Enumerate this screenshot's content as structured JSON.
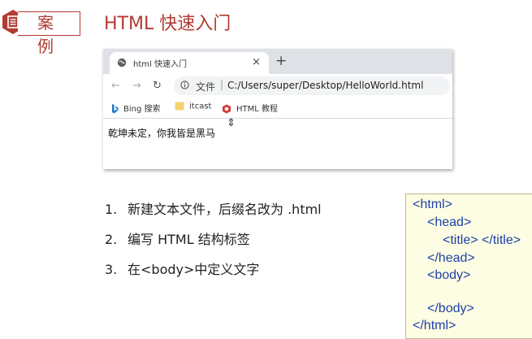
{
  "header": {
    "badge_label": "案例",
    "title": "HTML 快速入门"
  },
  "browser": {
    "tab_title": "html 快速入门",
    "tab_close": "×",
    "new_tab": "+",
    "nav_back": "←",
    "nav_forward": "→",
    "nav_reload": "↻",
    "omnibox_prefix": "文件",
    "omnibox_separator": "|",
    "url": "C:/Users/super/Desktop/HelloWorld.html",
    "bookmarks": [
      {
        "label": "Bing 搜索",
        "icon": "bing-icon",
        "color": "#1e73c7"
      },
      {
        "label": "itcast",
        "icon": "folder-icon",
        "color": "#f5d170"
      },
      {
        "label": "HTML 教程",
        "icon": "shield-logo-icon",
        "color": "#d33a3a"
      }
    ],
    "page_text": "乾坤未定，你我皆是黑马",
    "cursor": "⇕"
  },
  "steps": [
    {
      "num": "1.",
      "text": "新建文本文件，后缀名改为 .html"
    },
    {
      "num": "2.",
      "text": "编写 HTML 结构标签"
    },
    {
      "num": "3.",
      "text": "在<body>中定义文字"
    }
  ],
  "code": {
    "line1": "<html>",
    "line2": "<head>",
    "line3a": "<title>",
    "line3b": "</title>",
    "line4": "</head>",
    "line5": "<body>",
    "line6": "</body>",
    "line7": "</html>"
  },
  "colors": {
    "accent": "#b23a33",
    "code_tag": "#1f3fa8",
    "code_bg": "#fdfde3"
  }
}
